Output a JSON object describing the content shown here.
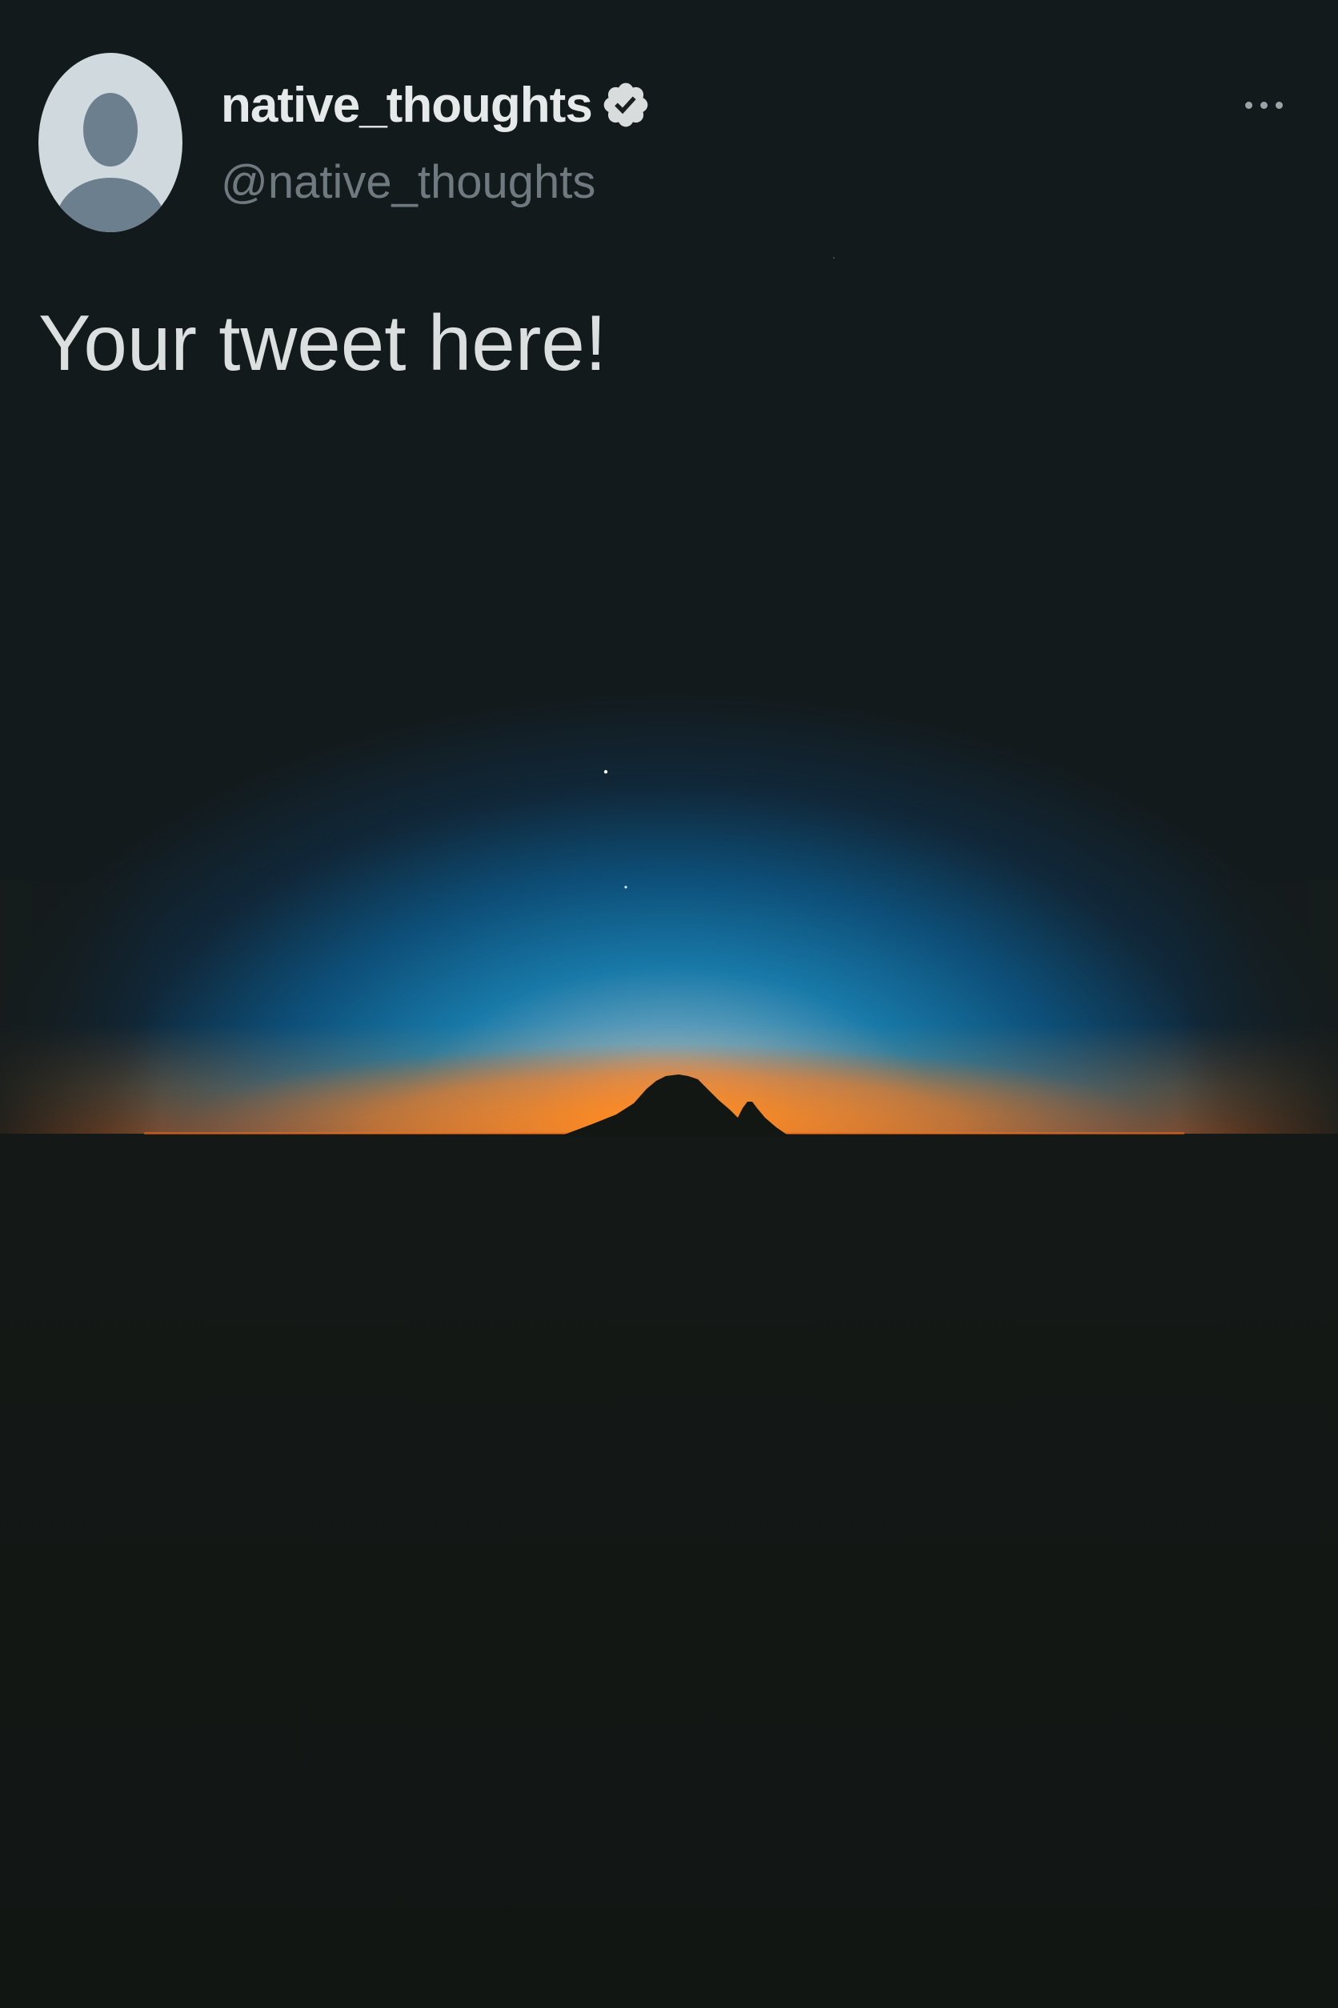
{
  "tweet": {
    "display_name": "native_thoughts",
    "handle": "@native_thoughts",
    "text": "Your tweet here!",
    "verified": true
  },
  "icons": {
    "avatar": "default-profile-avatar",
    "verified": "verified-badge-icon",
    "more": "more-options-icon"
  },
  "photo": {
    "subject": "sunset-horizon-with-mountain-silhouette"
  },
  "colors": {
    "background": "#131714",
    "text_primary": "#e6e9ea",
    "text_secondary": "#6f7a80",
    "sky_blue": "#0e6a9a",
    "horizon_orange": "#f07a10"
  }
}
